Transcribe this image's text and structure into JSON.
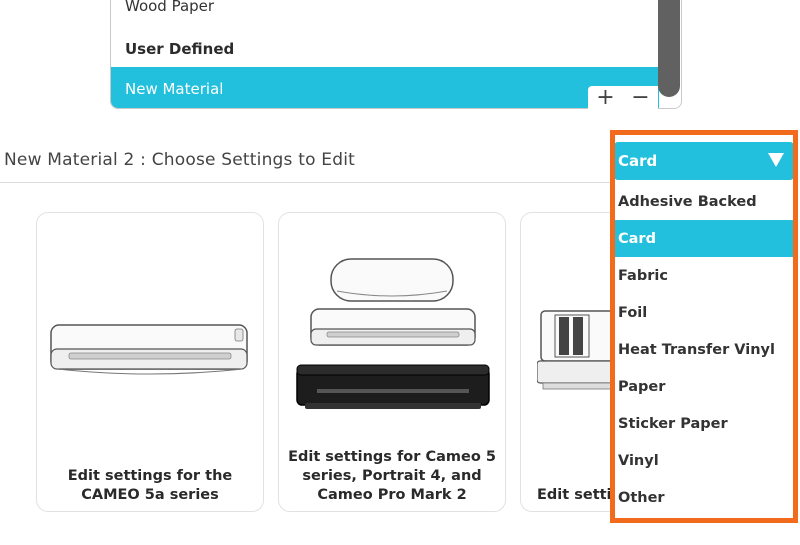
{
  "material_list": {
    "items": [
      {
        "label": "Wood Paper",
        "type": "item"
      },
      {
        "label": "User Defined",
        "type": "header"
      },
      {
        "label": "New Material",
        "type": "selected"
      }
    ],
    "add_symbol": "+",
    "remove_symbol": "−"
  },
  "settings": {
    "title": "New Material 2 : Choose Settings to Edit"
  },
  "cards": [
    {
      "label": "Edit settings for the CAMEO 5a series",
      "icon": "cameo-5a-machine-icon"
    },
    {
      "label": "Edit settings for Cameo 5 series, Portrait 4, and Cameo Pro Mark 2",
      "icon": "cameo-5-portrait-4-machine-icon"
    },
    {
      "label": "Edit setti",
      "icon": "cutting-machine-icon"
    }
  ],
  "material_type_dropdown": {
    "selected": "Card",
    "options": [
      "Adhesive Backed",
      "Card",
      "Fabric",
      "Foil",
      "Heat Transfer Vinyl",
      "Paper",
      "Sticker Paper",
      "Vinyl",
      "Other"
    ],
    "highlight_color": "#f26a1b",
    "accent_color": "#22c0dd"
  }
}
